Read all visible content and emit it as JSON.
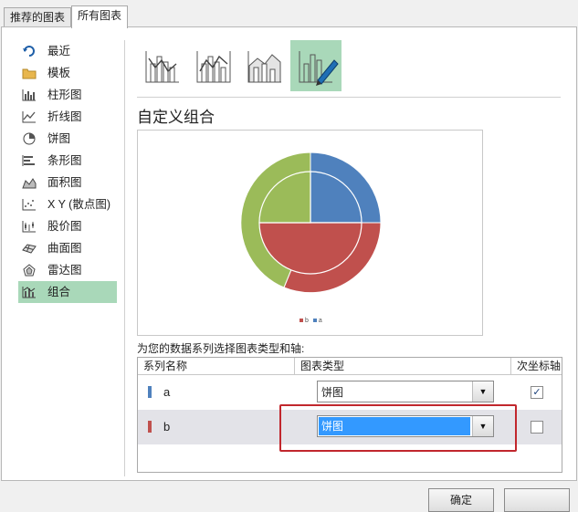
{
  "tabs": [
    {
      "label": "推荐的图表"
    },
    {
      "label": "所有图表"
    }
  ],
  "sidebar": {
    "items": [
      {
        "label": "最近",
        "icon": "recent-arrow-icon"
      },
      {
        "label": "模板",
        "icon": "folder-icon"
      },
      {
        "label": "柱形图",
        "icon": "column-chart-icon"
      },
      {
        "label": "折线图",
        "icon": "line-chart-icon"
      },
      {
        "label": "饼图",
        "icon": "pie-chart-icon"
      },
      {
        "label": "条形图",
        "icon": "bar-chart-icon"
      },
      {
        "label": "面积图",
        "icon": "area-chart-icon"
      },
      {
        "label": "X Y (散点图)",
        "icon": "scatter-chart-icon"
      },
      {
        "label": "股价图",
        "icon": "stock-chart-icon"
      },
      {
        "label": "曲面图",
        "icon": "surface-chart-icon"
      },
      {
        "label": "雷达图",
        "icon": "radar-chart-icon"
      },
      {
        "label": "组合",
        "icon": "combo-chart-icon",
        "selected": true
      }
    ]
  },
  "subtypes": [
    {
      "icon": "clustered-column-line-icon"
    },
    {
      "icon": "clustered-column-line-secondary-axis-icon"
    },
    {
      "icon": "stacked-area-clustered-column-icon"
    },
    {
      "icon": "custom-combination-icon",
      "selected": true
    }
  ],
  "main": {
    "title": "自定义组合",
    "series_prompt": "为您的数据系列选择图表类型和轴:",
    "columns": {
      "name": "系列名称",
      "type": "图表类型",
      "axis": "次坐标轴"
    },
    "rows": [
      {
        "name": "a",
        "color": "#4f81bd",
        "chart_type": "饼图",
        "secondary_axis": true
      },
      {
        "name": "b",
        "color": "#c0504d",
        "chart_type": "饼图",
        "secondary_axis": false
      }
    ]
  },
  "preview": {
    "legend": [
      {
        "name": "b",
        "color": "#c0504d"
      },
      {
        "name": "a",
        "color": "#4f81bd"
      }
    ],
    "colors": {
      "blue": "#4f81bd",
      "red": "#c0504d",
      "green": "#9bbb59"
    }
  },
  "buttons": {
    "ok": "确定"
  }
}
